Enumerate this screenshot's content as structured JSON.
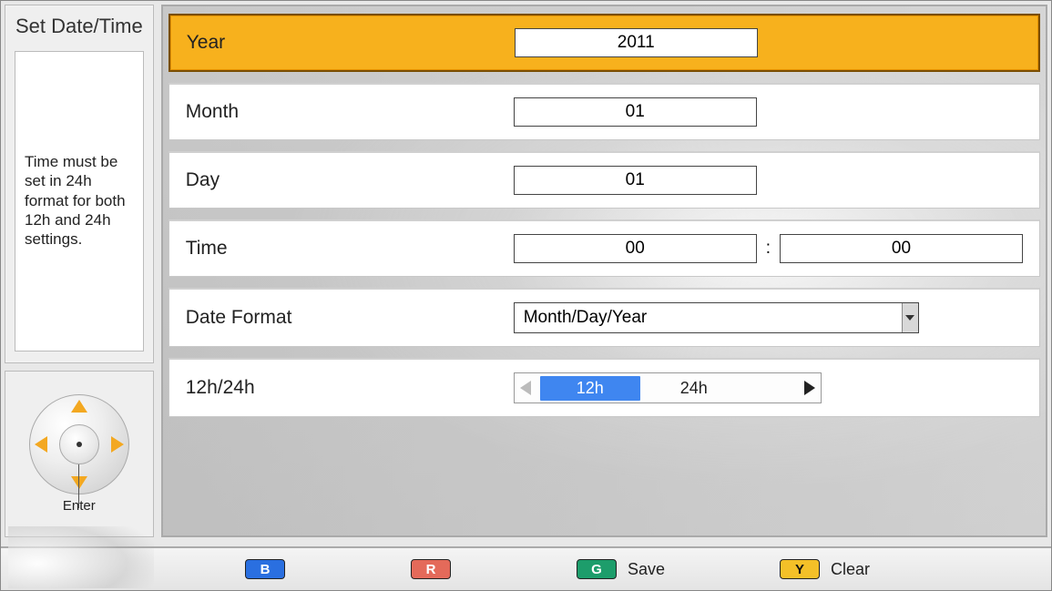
{
  "sidebar": {
    "title": "Set Date/Time",
    "help_text": "Time must be set in 24h format for both 12h and 24h settings.",
    "dpad_label": "Enter"
  },
  "settings": {
    "year": {
      "label": "Year",
      "value": "2011"
    },
    "month": {
      "label": "Month",
      "value": "01"
    },
    "day": {
      "label": "Day",
      "value": "01"
    },
    "time": {
      "label": "Time",
      "hour": "00",
      "minute": "00",
      "separator": ":"
    },
    "date_format": {
      "label": "Date Format",
      "value": "Month/Day/Year"
    },
    "clock_mode": {
      "label": "12h/24h",
      "options": [
        "12h",
        "24h"
      ],
      "selected": "12h"
    }
  },
  "hotkeys": {
    "b": {
      "key": "B",
      "label": ""
    },
    "r": {
      "key": "R",
      "label": ""
    },
    "g": {
      "key": "G",
      "label": "Save"
    },
    "y": {
      "key": "Y",
      "label": "Clear"
    }
  },
  "colors": {
    "highlight": "#f7b11d",
    "toggle_active": "#3f86f0",
    "key_blue": "#2a6fe0",
    "key_red": "#e46a5a",
    "key_green": "#1d9d6b",
    "key_yellow": "#f4c028"
  }
}
